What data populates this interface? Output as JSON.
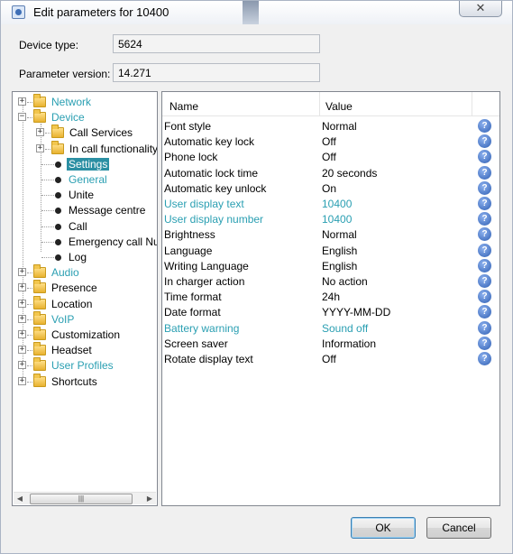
{
  "window": {
    "title": "Edit parameters for 10400",
    "close_glyph": "✕"
  },
  "fields": {
    "device_type_label": "Device type:",
    "device_type_value": "5624",
    "param_version_label": "Parameter version:",
    "param_version_value": "14.271"
  },
  "tree": {
    "expand_glyph": "+",
    "collapse_glyph": "−",
    "items": [
      {
        "label": "Network",
        "teal": true
      },
      {
        "label": "Device",
        "teal": true
      },
      {
        "label": "Call Services",
        "teal": false
      },
      {
        "label": "In call functionality",
        "teal": false
      },
      {
        "label": "Settings",
        "teal": false,
        "selected": true
      },
      {
        "label": "General",
        "teal": true
      },
      {
        "label": "Unite",
        "teal": false
      },
      {
        "label": "Message centre",
        "teal": false
      },
      {
        "label": "Call",
        "teal": false
      },
      {
        "label": "Emergency call Nur",
        "teal": false
      },
      {
        "label": "Log",
        "teal": false
      },
      {
        "label": "Audio",
        "teal": true
      },
      {
        "label": "Presence",
        "teal": false
      },
      {
        "label": "Location",
        "teal": false
      },
      {
        "label": "VoIP",
        "teal": true
      },
      {
        "label": "Customization",
        "teal": false
      },
      {
        "label": "Headset",
        "teal": false
      },
      {
        "label": "User Profiles",
        "teal": true
      },
      {
        "label": "Shortcuts",
        "teal": false
      }
    ],
    "scroll_left_glyph": "◀",
    "scroll_right_glyph": "▶",
    "scroll_thumb_glyph": "|||"
  },
  "table": {
    "col_name": "Name",
    "col_value": "Value",
    "help_glyph": "?",
    "rows": [
      {
        "name": "Font style",
        "value": "Normal",
        "teal": false
      },
      {
        "name": "Automatic key lock",
        "value": "Off",
        "teal": false
      },
      {
        "name": "Phone lock",
        "value": "Off",
        "teal": false
      },
      {
        "name": "Automatic lock time",
        "value": "20 seconds",
        "teal": false
      },
      {
        "name": "Automatic key unlock",
        "value": "On",
        "teal": false
      },
      {
        "name": "User display text",
        "value": "10400",
        "teal": true
      },
      {
        "name": "User display number",
        "value": "10400",
        "teal": true
      },
      {
        "name": "Brightness",
        "value": "Normal",
        "teal": false
      },
      {
        "name": "Language",
        "value": "English",
        "teal": false
      },
      {
        "name": "Writing Language",
        "value": "English",
        "teal": false
      },
      {
        "name": "In charger action",
        "value": "No action",
        "teal": false
      },
      {
        "name": "Time format",
        "value": "24h",
        "teal": false
      },
      {
        "name": "Date format",
        "value": "YYYY-MM-DD",
        "teal": false
      },
      {
        "name": "Battery warning",
        "value": "Sound off",
        "teal": true
      },
      {
        "name": "Screen saver",
        "value": "Information",
        "teal": false
      },
      {
        "name": "Rotate display text",
        "value": "Off",
        "teal": false
      }
    ]
  },
  "buttons": {
    "ok": "OK",
    "cancel": "Cancel"
  }
}
